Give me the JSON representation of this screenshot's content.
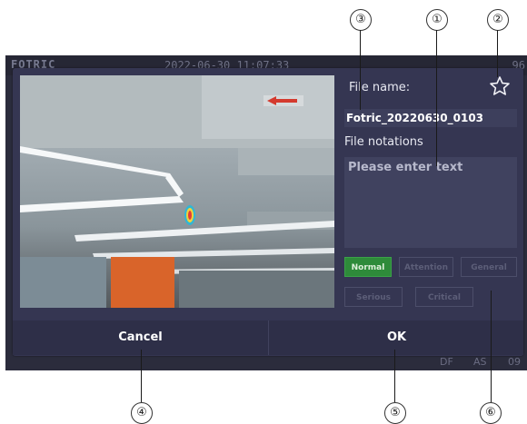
{
  "device": {
    "logo": "FOTRIC",
    "time": "2022-06-30 11:07:33",
    "battery": "96",
    "bottom_labels": [
      "DF",
      "AS",
      "09"
    ]
  },
  "dialog": {
    "file_name_label": "File name:",
    "file_name_value": "Fotric_20220630_0103",
    "notations_label": "File notations",
    "notations_placeholder": "Please enter text",
    "tags": [
      {
        "label": "Normal",
        "active": true
      },
      {
        "label": "Attention",
        "active": false
      },
      {
        "label": "General",
        "active": false
      },
      {
        "label": "Serious",
        "active": false
      },
      {
        "label": "Critical",
        "active": false
      }
    ],
    "cancel_label": "Cancel",
    "ok_label": "OK",
    "star_icon": "star-outline-icon"
  },
  "callouts": [
    "①",
    "②",
    "③",
    "④",
    "⑤",
    "⑥"
  ],
  "colors": {
    "dialog_bg": "#353652",
    "tag_active": "#2e8b3a",
    "accent_hotspot": "#e23b3b"
  }
}
